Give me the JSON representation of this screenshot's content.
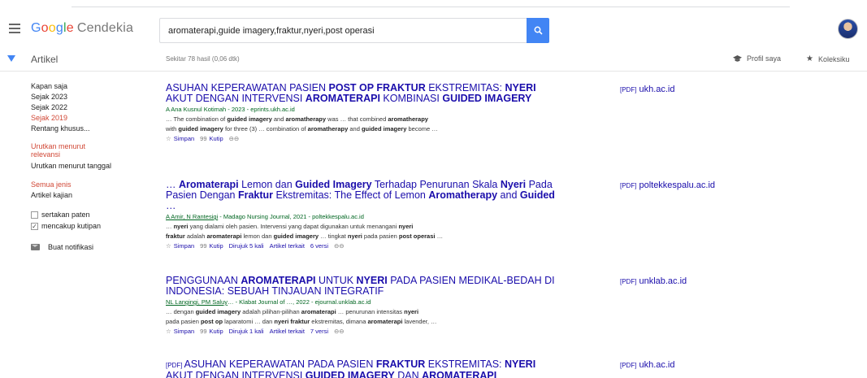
{
  "header": {
    "logo_parts": [
      "G",
      "o",
      "o",
      "g",
      "l",
      "e"
    ],
    "logo_suffix": "Cendekia",
    "search_value": "aromaterapi,guide imagery,fraktur,nyeri,post operasi"
  },
  "subheader": {
    "section": "Artikel",
    "result_count": "Sekitar 78 hasil (0,06 dtk)",
    "profile": "Profil saya",
    "library": "Koleksiku"
  },
  "sidebar": {
    "time": [
      "Kapan saja",
      "Sejak 2023",
      "Sejak 2022",
      "Sejak 2019",
      "Rentang khusus..."
    ],
    "sort_relevance": "Urutkan menurut relevansi",
    "sort_date": "Urutkan menurut tanggal",
    "type_all": "Semua jenis",
    "type_review": "Artikel kajian",
    "include_patents": "sertakan paten",
    "include_citations": "mencakup kutipan",
    "create_alert": "Buat notifikasi"
  },
  "results": [
    {
      "side": "ukh.ac.id",
      "authors": "A Ana Kusnul Kotimah - 2023 - eprints.ukh.ac.id",
      "actions": {
        "save": "Simpan",
        "cite": "Kutip"
      }
    },
    {
      "side": "poltekkespalu.ac.id",
      "authors_link": "A Amir, N Rantesigi",
      "authors_rest": " - Madago Nursing Journal, 2021 - poltekkespalu.ac.id",
      "actions": {
        "save": "Simpan",
        "cite": "Kutip",
        "cited": "Dirujuk 5 kali",
        "related": "Artikel terkait",
        "versions": "6 versi"
      }
    },
    {
      "side": "unklab.ac.id",
      "authors_link": "NL Langingi, PM Saluy",
      "authors_rest": "… - Klabat Journal of …, 2022 - ejournal.unklab.ac.id",
      "actions": {
        "save": "Simpan",
        "cite": "Kutip",
        "cited": "Dirujuk 1 kali",
        "related": "Artikel terkait",
        "versions": "7 versi"
      }
    },
    {
      "side": "ukh.ac.id"
    }
  ],
  "labels": {
    "pdf": "[PDF]"
  },
  "colors": {
    "accent": "#4285f4",
    "link": "#1a0dab",
    "source": "#006621",
    "active": "#d14836"
  }
}
